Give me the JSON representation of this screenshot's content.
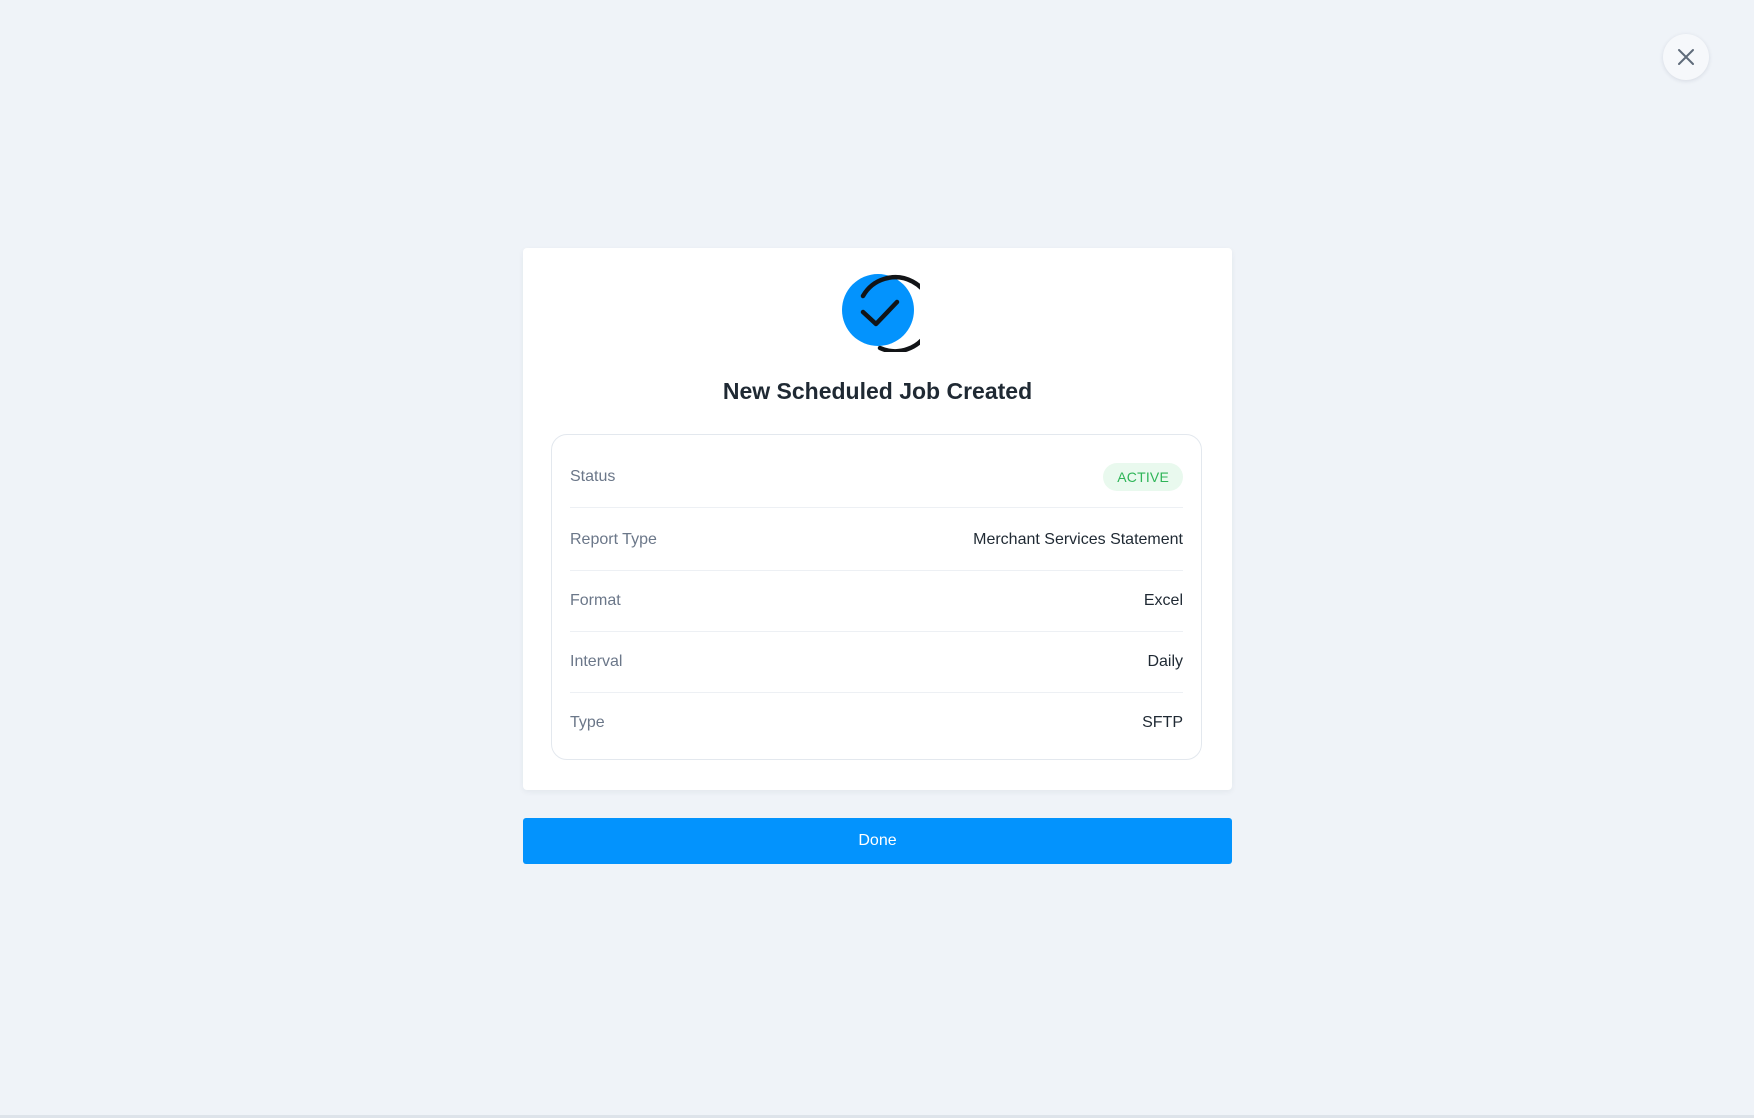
{
  "header": {
    "close_icon": "close-icon"
  },
  "modal": {
    "icon": "check-circle-icon",
    "title": "New Scheduled Job Created",
    "status": {
      "label": "Status",
      "value": "ACTIVE"
    },
    "details": [
      {
        "label": "Report Type",
        "value": "Merchant Services Statement"
      },
      {
        "label": "Format",
        "value": "Excel"
      },
      {
        "label": "Interval",
        "value": "Daily"
      },
      {
        "label": "Type",
        "value": "SFTP"
      }
    ]
  },
  "actions": {
    "done_label": "Done"
  },
  "colors": {
    "accent": "#0393fd",
    "background": "#eff3f8",
    "status_active_text": "#2fb558",
    "status_active_bg": "#e9f9ee",
    "title_text": "#1f2933",
    "label_text": "#6b7789"
  }
}
